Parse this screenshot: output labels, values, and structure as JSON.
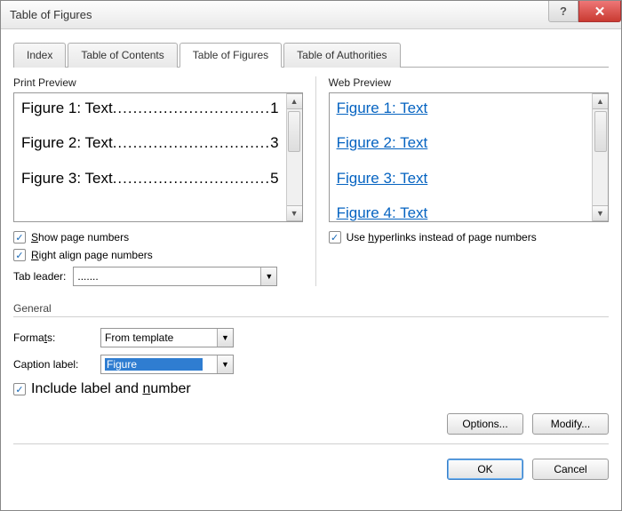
{
  "title": "Table of Figures",
  "tabs": {
    "index": "Index",
    "toc": "Table of Contents",
    "tof": "Table of Figures",
    "toa": "Table of Authorities"
  },
  "print_preview_label": "Print Preview",
  "web_preview_label": "Web Preview",
  "print_entries": {
    "e1_text": "Figure 1: Text",
    "e1_page": "1",
    "e2_text": "Figure 2: Text",
    "e2_page": "3",
    "e3_text": "Figure 3: Text",
    "e3_page": "5"
  },
  "web_entries": {
    "e1": "Figure 1: Text",
    "e2": "Figure 2: Text",
    "e3": "Figure 3: Text",
    "e4": "Figure 4: Text"
  },
  "checks": {
    "show_page_numbers": "Show page numbers",
    "right_align_page_numbers": "Right align page numbers",
    "use_hyperlinks": "Use hyperlinks instead of page numbers",
    "include_label_number": "Include label and number"
  },
  "tab_leader_label": "Tab leader:",
  "tab_leader_value": ".......",
  "general_label": "General",
  "formats_label": "Formats:",
  "formats_value": "From template",
  "caption_label_label": "Caption label:",
  "caption_label_value": "Figure",
  "buttons": {
    "options": "Options...",
    "modify": "Modify...",
    "ok": "OK",
    "cancel": "Cancel"
  },
  "dots": "...............................",
  "help_symbol": "?",
  "close_symbol": "✕"
}
